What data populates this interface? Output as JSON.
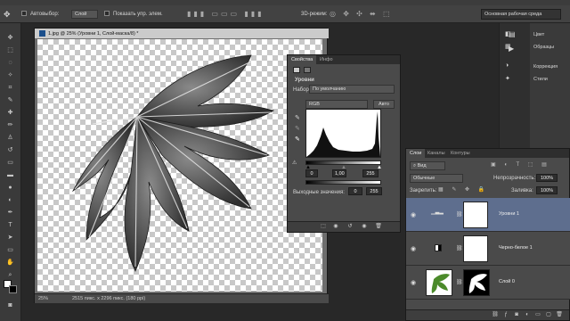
{
  "options": {
    "autoselect_label": "Автовыбор:",
    "autoselect_value": "Слой",
    "show_controls_label": "Показать упр. элем.",
    "mode_3d_label": "3D-режим:"
  },
  "workspace": {
    "value": "Основная рабочая среда"
  },
  "document": {
    "title": "1.jpg @ 25% (Уровни 1, Слой-маска/8) *",
    "zoom": "25%",
    "size_info": "2515 пикс. x 2296 пикс. (180 ppi)"
  },
  "properties": {
    "tab_properties": "Свойства",
    "tab_info": "Инфо",
    "heading": "Уровни",
    "preset_label": "Набор:",
    "preset_value": "По умолчанию",
    "channel": "RGB",
    "auto_button": "Авто",
    "input_black": "0",
    "input_gamma": "1,00",
    "input_white": "255",
    "output_label": "Выходные значения:",
    "output_black": "0",
    "output_white": "255"
  },
  "right_panels": {
    "color": "Цвет",
    "swatches": "Образцы",
    "adjustments": "Коррекция",
    "styles": "Стили"
  },
  "layers": {
    "tab_layers": "Слои",
    "tab_channels": "Каналы",
    "tab_paths": "Контуры",
    "filter_kind": "Вид",
    "blend_mode": "Обычные",
    "opacity_label": "Непрозрачность:",
    "opacity_value": "100%",
    "lock_label": "Закрепить:",
    "fill_label": "Заливка:",
    "fill_value": "100%",
    "items": [
      {
        "name": "Уровни 1"
      },
      {
        "name": "Черно-белое 1"
      },
      {
        "name": "Слой 0"
      }
    ]
  }
}
